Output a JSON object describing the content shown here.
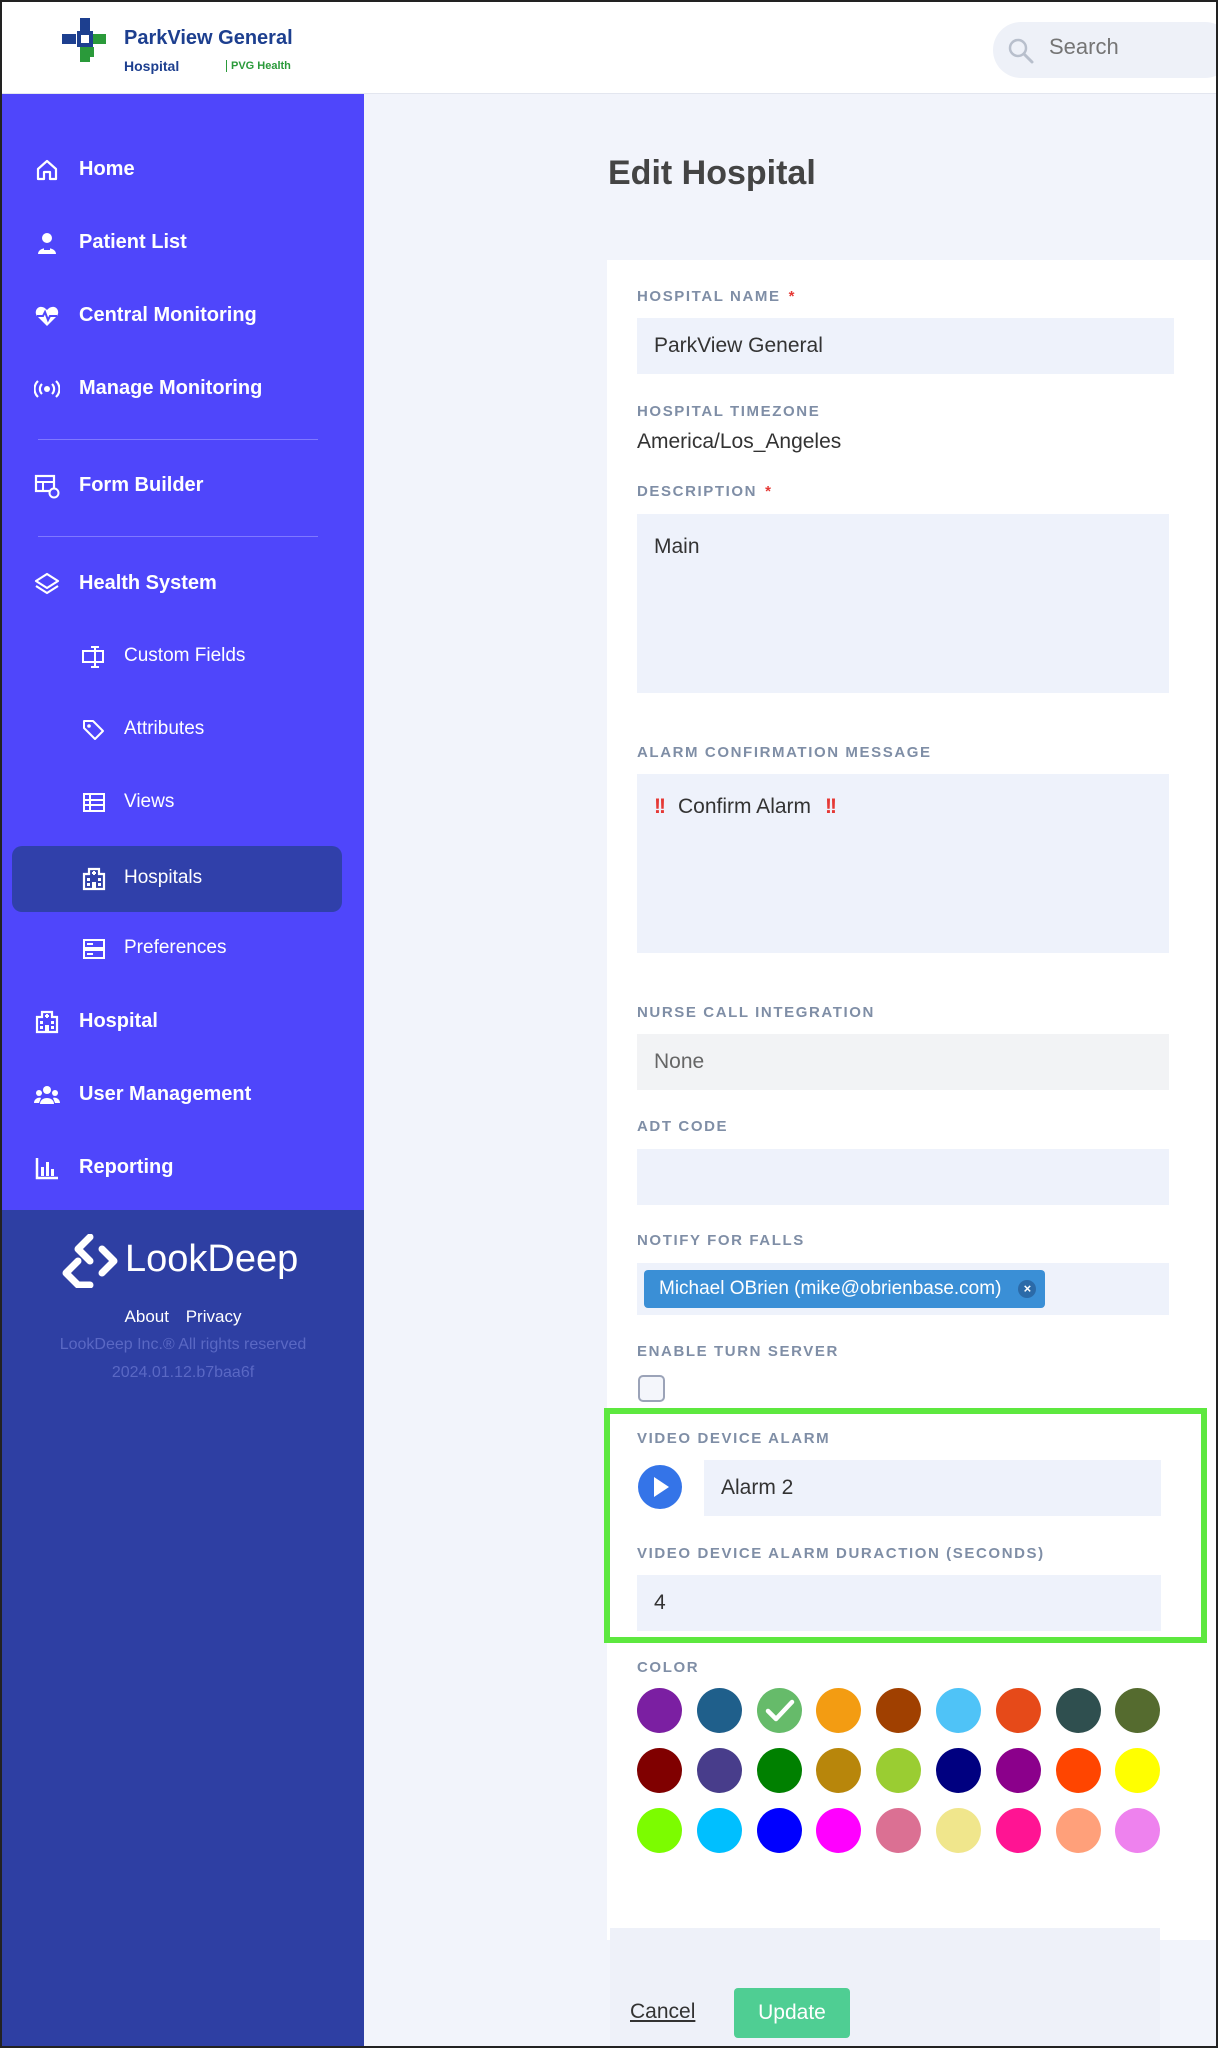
{
  "header": {
    "brand_name": "ParkView General",
    "brand_sub": "Hospital",
    "brand_tag": "PVG Health",
    "search_placeholder": "Search"
  },
  "sidebar": {
    "items": [
      {
        "label": "Home",
        "icon": "home-icon"
      },
      {
        "label": "Patient List",
        "icon": "patient-icon"
      },
      {
        "label": "Central Monitoring",
        "icon": "heartbeat-icon"
      },
      {
        "label": "Manage Monitoring",
        "icon": "broadcast-icon"
      },
      {
        "label": "Form Builder",
        "icon": "form-builder-icon"
      },
      {
        "label": "Health System",
        "icon": "layers-icon"
      },
      {
        "label": "Custom Fields",
        "icon": "custom-fields-icon"
      },
      {
        "label": "Attributes",
        "icon": "tags-icon"
      },
      {
        "label": "Views",
        "icon": "views-icon"
      },
      {
        "label": "Hospitals",
        "icon": "hospital-icon",
        "active": true
      },
      {
        "label": "Preferences",
        "icon": "preferences-icon"
      },
      {
        "label": "Hospital",
        "icon": "hospital-icon"
      },
      {
        "label": "User Management",
        "icon": "users-icon"
      },
      {
        "label": "Reporting",
        "icon": "reporting-icon"
      }
    ],
    "footer": {
      "brand": "LookDeep",
      "about": "About",
      "privacy": "Privacy",
      "copyright": "LookDeep Inc.® All rights reserved",
      "version": "2024.01.12.b7baa6f"
    }
  },
  "form": {
    "title": "Edit Hospital",
    "hospital_name_label": "HOSPITAL NAME",
    "hospital_name_value": "ParkView General",
    "required_mark": "*",
    "timezone_label": "HOSPITAL TIMEZONE",
    "timezone_value": "America/Los_Angeles",
    "description_label": "DESCRIPTION",
    "description_value": "Main",
    "alarm_confirm_label": "ALARM CONFIRMATION MESSAGE",
    "alarm_confirm_bang": "!!",
    "alarm_confirm_value": "Confirm Alarm",
    "nurse_call_label": "NURSE CALL INTEGRATION",
    "nurse_call_value": "None",
    "adt_label": "ADT CODE",
    "adt_value": "",
    "notify_label": "NOTIFY FOR FALLS",
    "notify_chip": "Michael OBrien (mike@obrienbase.com)",
    "notify_chip_remove": "×",
    "turn_label": "ENABLE TURN SERVER",
    "turn_checked": false,
    "video_alarm_label": "VIDEO DEVICE ALARM",
    "video_alarm_value": "Alarm 2",
    "alarm_duration_label": "VIDEO DEVICE ALARM DURACTION (SECONDS)",
    "alarm_duration_value": "4",
    "color_label": "COLOR",
    "selected_color": "#66bb6a",
    "colors": [
      "#7b1fa2",
      "#1f5f8b",
      "#66bb6a",
      "#f39c12",
      "#a04000",
      "#4fc3f7",
      "#e64a19",
      "#2f4f4f",
      "#556b2f",
      "#800000",
      "#483d8b",
      "#008000",
      "#b8860b",
      "#9acd32",
      "#000080",
      "#8b008b",
      "#ff4500",
      "#ffff00",
      "#7cfc00",
      "#00bfff",
      "#0000ff",
      "#ff00ff",
      "#db7093",
      "#f0e68c",
      "#ff1493",
      "#ffa07a",
      "#ee82ee"
    ],
    "cancel_label": "Cancel",
    "update_label": "Update"
  }
}
